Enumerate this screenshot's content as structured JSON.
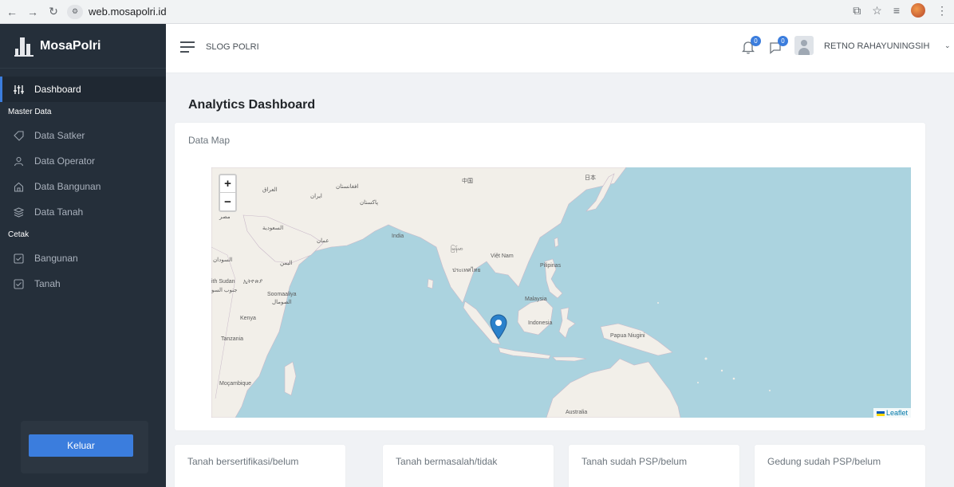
{
  "browser": {
    "url": "web.mosapolri.id"
  },
  "sidebar": {
    "brand": "MosaPolri",
    "dashboard": "Dashboard",
    "master_heading": "Master Data",
    "master_items": [
      "Data Satker",
      "Data Operator",
      "Data Bangunan",
      "Data Tanah"
    ],
    "cetak_heading": "Cetak",
    "cetak_items": [
      "Bangunan",
      "Tanah"
    ],
    "logout": "Keluar"
  },
  "topnav": {
    "title": "SLOG POLRI",
    "notification_count": "0",
    "message_count": "0",
    "user_name": "RETNO RAHAYUNINGSIH"
  },
  "page": {
    "title_bold": "Analytics",
    "title_rest": " Dashboard"
  },
  "map": {
    "card_title": "Data Map",
    "zoom_in": "+",
    "zoom_out": "−",
    "attribution": "Leaflet",
    "labels": {
      "china": "中国",
      "japan": "日本",
      "india": "India",
      "myanmar": "မြန်မာ",
      "vietnam": "Việt Nam",
      "thailand": "ประเทศไทย",
      "philippines": "Pilipinas",
      "malaysia": "Malaysia",
      "indonesia": "Indonesia",
      "png": "Papua Niugini",
      "australia": "Australia",
      "iraq": "العراق",
      "iran": "ایران",
      "afghanistan": "افغانستان",
      "pakistan": "پاکستان",
      "egypt": "مصر",
      "saudi": "السعودية",
      "oman": "عمان",
      "sudan": "السودان",
      "yemen": "اليمن",
      "south_sudan": "ith Sudan",
      "south_sudan_ar": "جنوب السو",
      "ethiopia": "ኢትዮጵያ",
      "somalia": "Soomaaliya",
      "somalia_ar": "الصومال",
      "kenya": "Kenya",
      "tanzania": "Tanzania",
      "mozambique": "Moçambique"
    },
    "colors": {
      "sea": "#abd3df",
      "land": "#f2efe9",
      "marker": "#2a81cb"
    }
  },
  "stats": [
    "Tanah bersertifikasi/belum",
    "Tanah bermasalah/tidak",
    "Tanah sudah PSP/belum",
    "Gedung sudah PSP/belum"
  ],
  "colors": {
    "sidebar": "#252f3a",
    "accent": "#3b7ddd"
  }
}
